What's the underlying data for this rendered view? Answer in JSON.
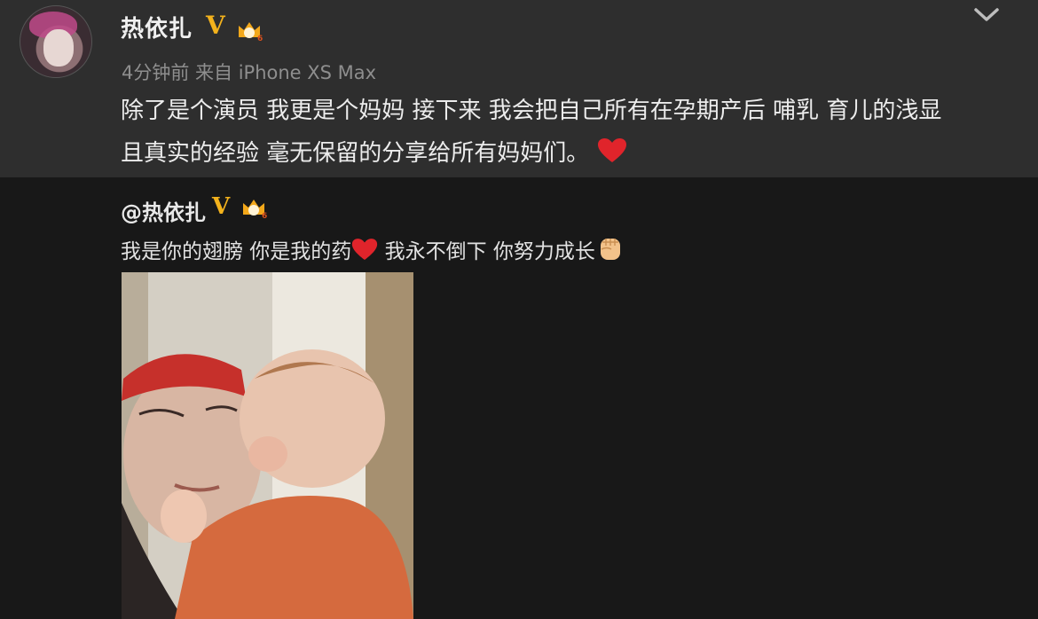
{
  "post": {
    "username": "热依扎",
    "verified_badge": "V",
    "meta": "4分钟前 来自 iPhone XS Max",
    "text_line1": "除了是个演员 我更是个妈妈 接下来 我会把自己所有在孕期产后 哺乳 育儿的浅显",
    "text_line2": "且真实的经验 毫无保留的分享给所有妈妈们。"
  },
  "repost": {
    "mention": "@热依扎",
    "verified_badge": "V",
    "text_part1": "我是你的翅膀 你是我的药",
    "text_part2": " 我永不倒下 你努力成长"
  },
  "icons": {
    "heart": "heart-icon",
    "fist": "raised-fist-icon",
    "crown": "crown-level-icon",
    "chevron": "chevron-down-icon"
  },
  "colors": {
    "post_bg": "#2e2e2e",
    "page_bg": "#181818",
    "verified": "#f3b21c",
    "heart": "#e0242b"
  }
}
